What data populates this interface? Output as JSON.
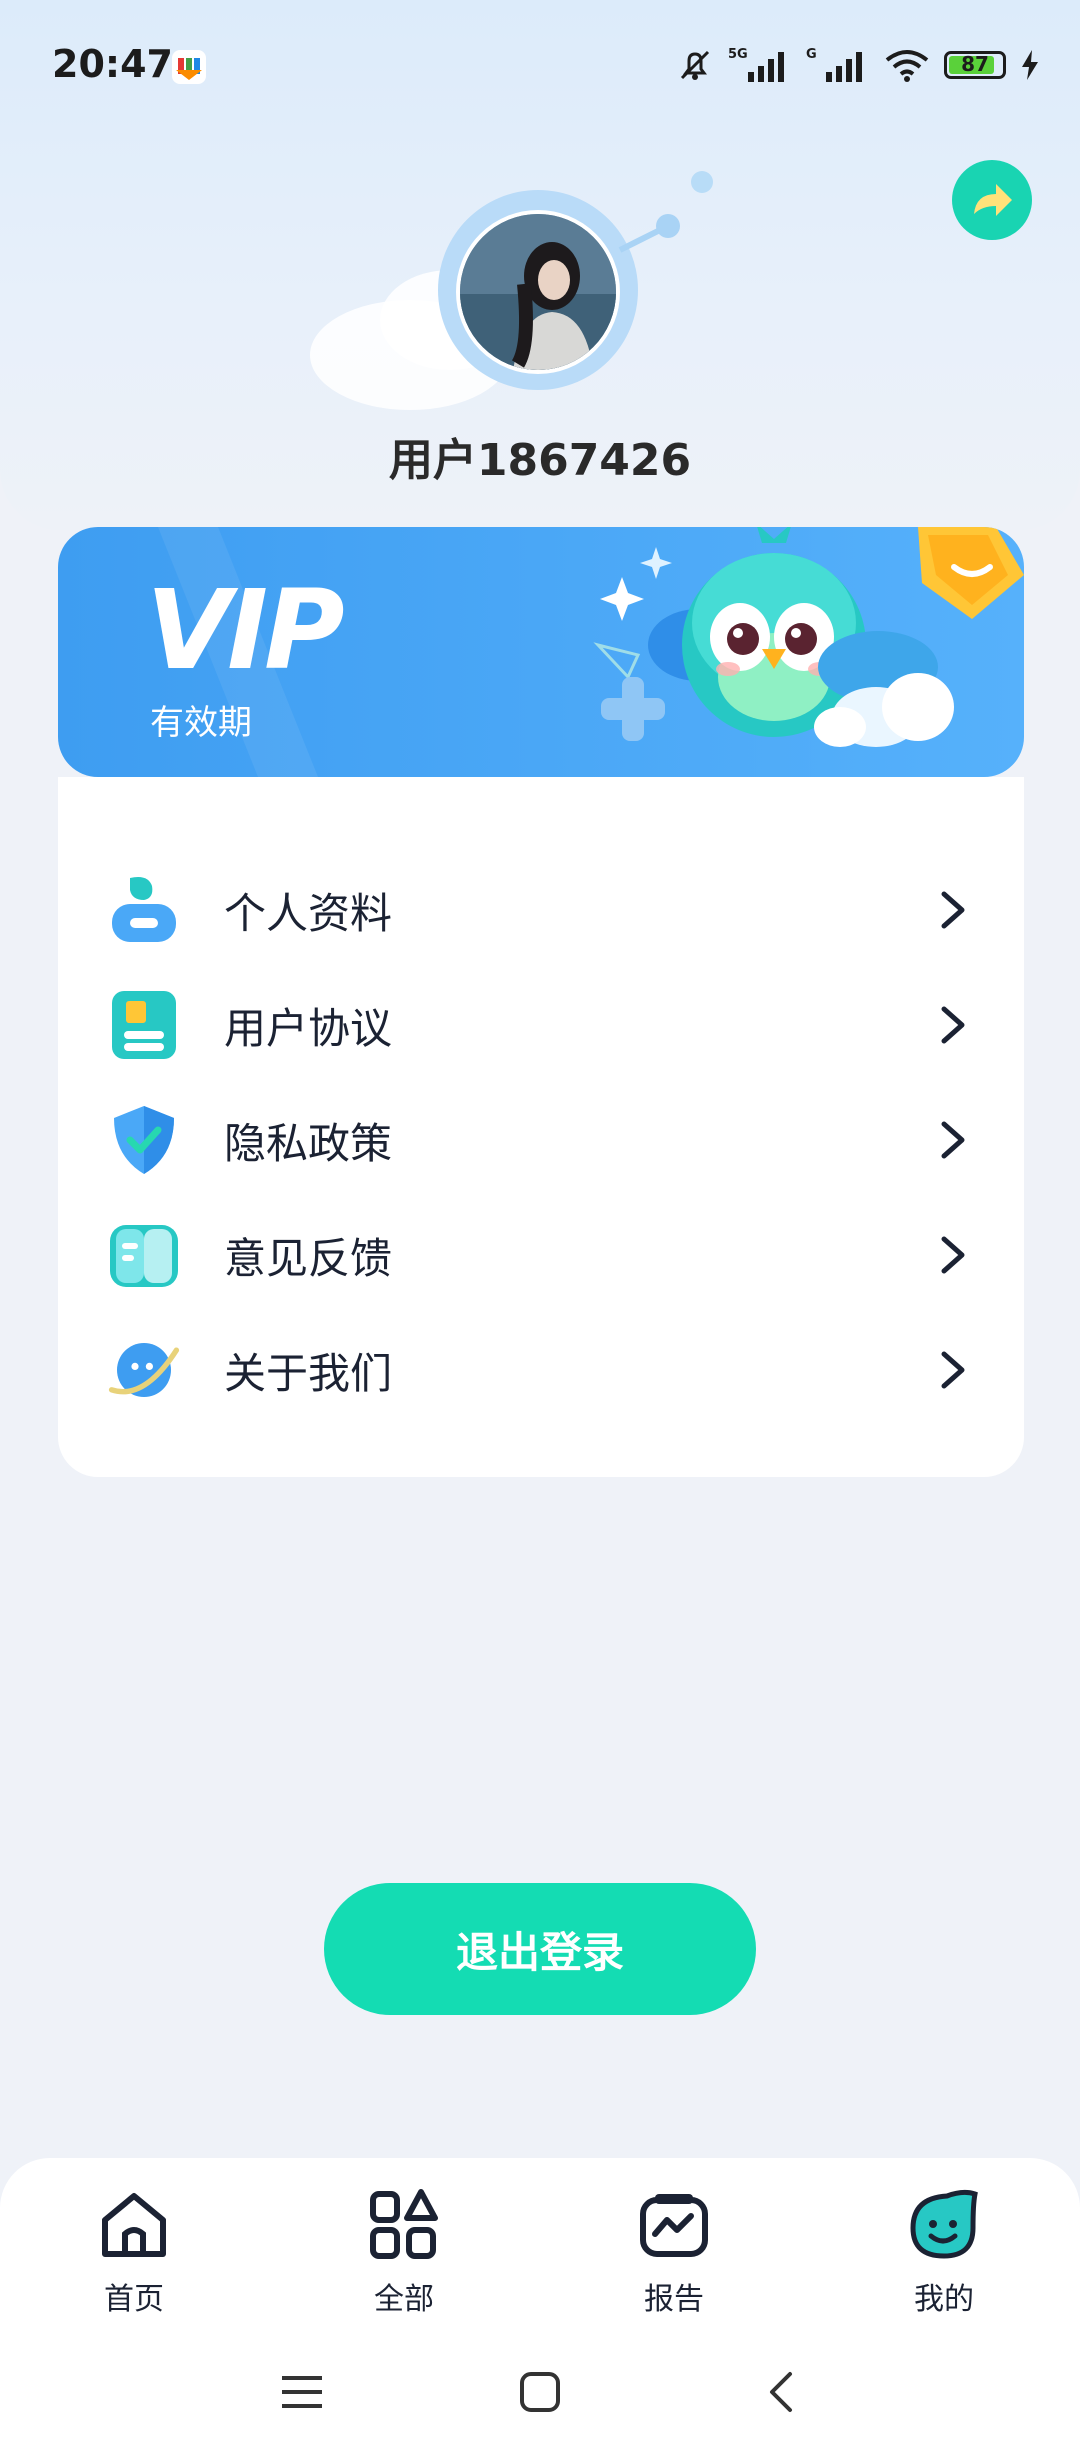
{
  "status": {
    "time": "20:47",
    "battery": "87",
    "battery_level": 0.87,
    "network_1": "5G",
    "network_2": "G"
  },
  "profile": {
    "username": "用户1867426"
  },
  "vip": {
    "title": "VIP",
    "validity": "有效期"
  },
  "menu": [
    {
      "label": "个人资料",
      "icon": "person-icon"
    },
    {
      "label": "用户协议",
      "icon": "document-icon"
    },
    {
      "label": "隐私政策",
      "icon": "shield-check-icon"
    },
    {
      "label": "意见反馈",
      "icon": "book-icon"
    },
    {
      "label": "关于我们",
      "icon": "planet-icon"
    }
  ],
  "logout": {
    "label": "退出登录"
  },
  "nav": [
    {
      "label": "首页",
      "icon": "home-icon"
    },
    {
      "label": "全部",
      "icon": "grid-icon"
    },
    {
      "label": "报告",
      "icon": "report-icon"
    },
    {
      "label": "我的",
      "icon": "smile-icon",
      "active": true
    }
  ],
  "colors": {
    "accent": "#14dcb3",
    "vip": "#4aa8f7",
    "text": "#1b2233"
  }
}
